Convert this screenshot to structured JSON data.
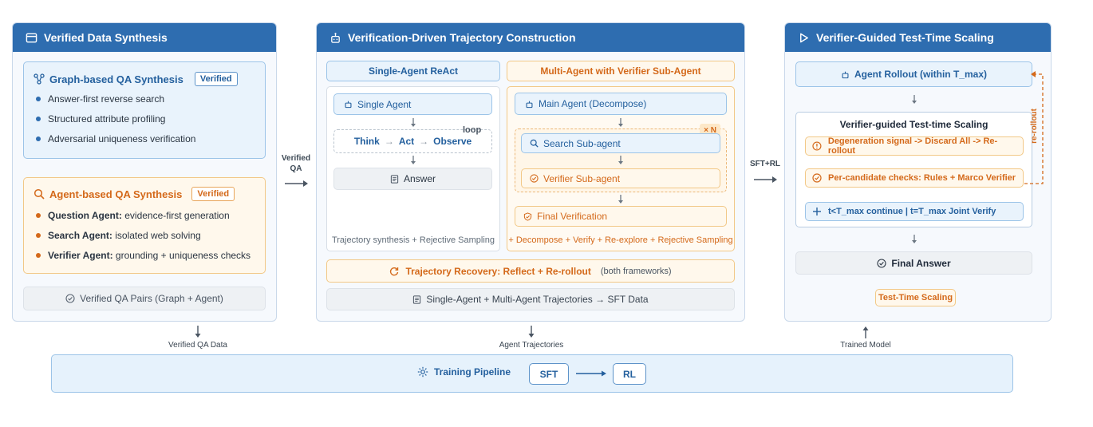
{
  "panel1": {
    "title": "Verified Data Synthesis",
    "graph_title": "Graph-based QA Synthesis",
    "graph_badge": "Verified",
    "graph_items": [
      "Answer-first reverse search",
      "Structured attribute profiling",
      "Adversarial uniqueness verification"
    ],
    "agent_title": "Agent-based QA Synthesis",
    "agent_badge": "Verified",
    "agent_items": [
      {
        "bold": "Question Agent:",
        "rest": "evidence-first generation"
      },
      {
        "bold": "Search Agent:",
        "rest": "isolated web solving"
      },
      {
        "bold": "Verifier Agent:",
        "rest": "grounding + uniqueness checks"
      }
    ],
    "output": "Verified QA Pairs (Graph + Agent)"
  },
  "connector1": {
    "line1": "Verified",
    "line2": "QA"
  },
  "panel2": {
    "title": "Verification-Driven Trajectory Construction",
    "single_header": "Single-Agent ReAct",
    "multi_header": "Multi-Agent with Verifier Sub-Agent",
    "single_agent": "Single Agent",
    "think": "Think",
    "act": "Act",
    "observe": "Observe",
    "loop": "loop",
    "answer": "Answer",
    "single_footer": "Trajectory synthesis + Rejective Sampling",
    "main_agent": "Main Agent (Decompose)",
    "times_n": "× N",
    "search_sub": "Search Sub-agent",
    "verifier_sub": "Verifier Sub-agent",
    "final_verification": "Final Verification",
    "multi_footer": "+ Decompose + Verify + Re-explore + Rejective Sampling",
    "recovery": "Trajectory Recovery: Reflect + Re-rollout",
    "recovery_note": "(both frameworks)",
    "output": "Single-Agent + Multi-Agent Trajectories → SFT Data"
  },
  "connector2": {
    "label": "SFT+RL"
  },
  "panel3": {
    "title": "Verifier-Guided Test-Time Scaling",
    "rollout": "Agent Rollout (within T_max)",
    "rerollout": "re-rollout",
    "scaling_title": "Verifier-guided Test-time Scaling",
    "degeneration": "Degeneration signal -> Discard All -> Re-rollout",
    "checks": "Per-candidate checks: Rules + Marco Verifier",
    "continue": "t<T_max continue | t=T_max Joint Verify",
    "final_answer": "Final Answer",
    "badge": "Test-Time Scaling"
  },
  "flows": {
    "left": "Verified QA Data",
    "middle": "Agent Trajectories",
    "right": "Trained Model"
  },
  "pipeline": {
    "title": "Training Pipeline",
    "sft": "SFT",
    "rl": "RL"
  },
  "colors": {
    "header": "#2e6db0",
    "blue": "#24609e",
    "orange": "#d4691a"
  },
  "icons": [
    "window-icon",
    "robot-icon",
    "play-icon",
    "graph-icon",
    "search-icon",
    "check-circle-icon",
    "document-icon",
    "refresh-icon",
    "warning-icon",
    "plus-icon",
    "gear-icon"
  ]
}
